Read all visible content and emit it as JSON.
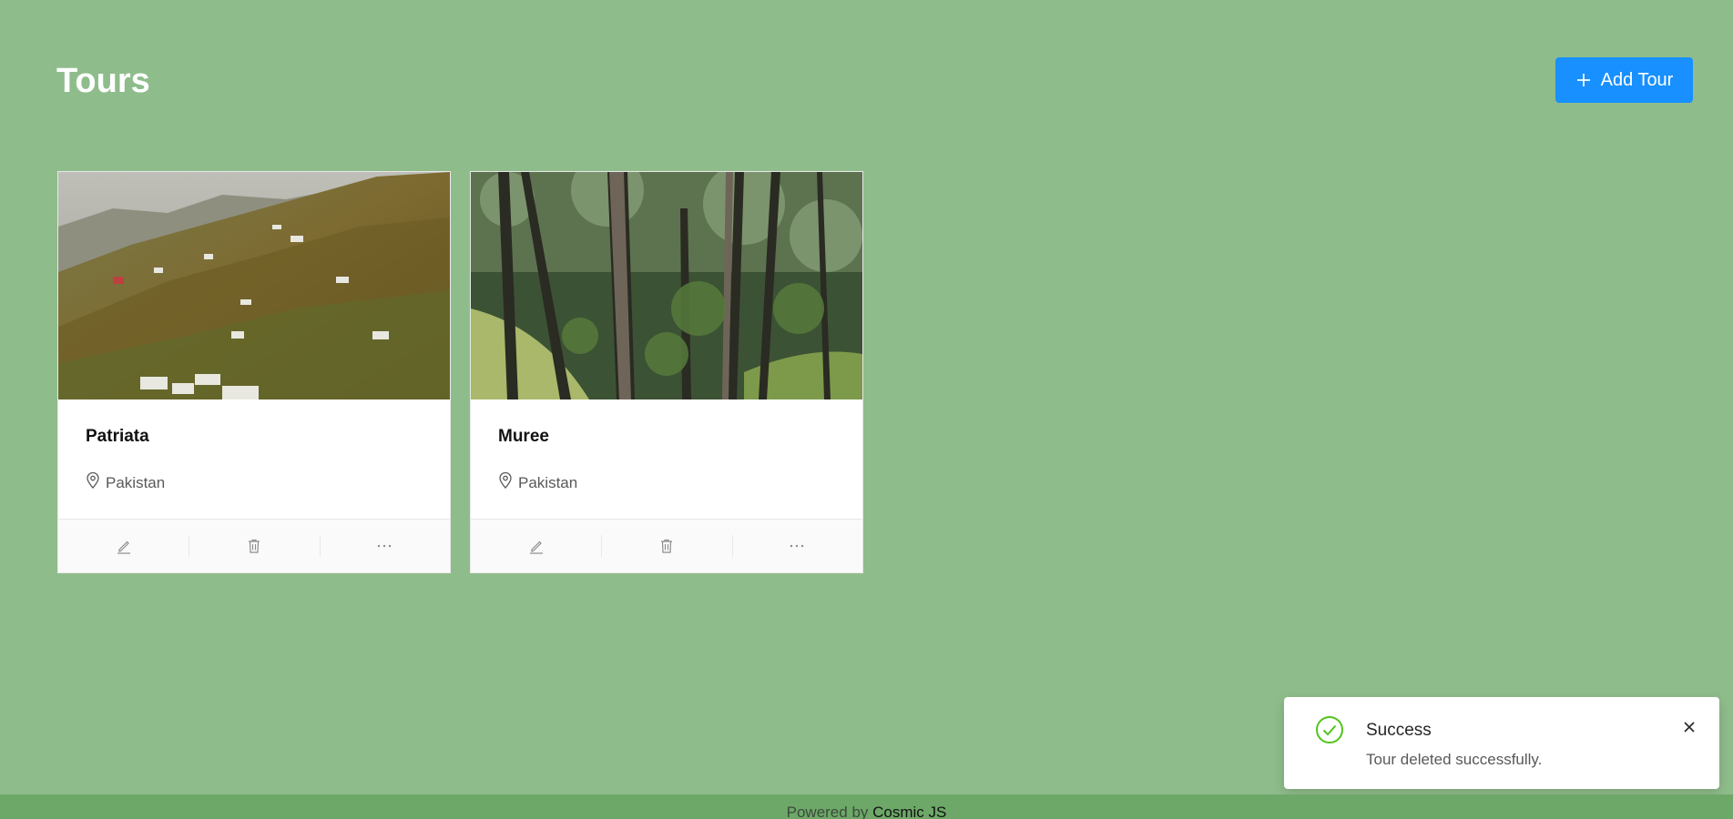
{
  "header": {
    "title": "Tours",
    "add_label": "Add Tour"
  },
  "tours": [
    {
      "title": "Patriata",
      "location": "Pakistan"
    },
    {
      "title": "Muree",
      "location": "Pakistan"
    }
  ],
  "toast": {
    "title": "Success",
    "message": "Tour deleted successfully."
  },
  "footer": {
    "prefix": "Powered by",
    "brand": "Cosmic JS"
  },
  "colors": {
    "background": "#8fbc8b",
    "primary": "#1890ff",
    "footer": "#6da868",
    "success": "#52c41a"
  },
  "icons": {
    "add": "plus-icon",
    "location": "map-pin-icon",
    "edit": "pencil-icon",
    "delete": "trash-icon",
    "more": "ellipsis-icon",
    "success": "check-circle-icon",
    "close": "close-icon"
  }
}
